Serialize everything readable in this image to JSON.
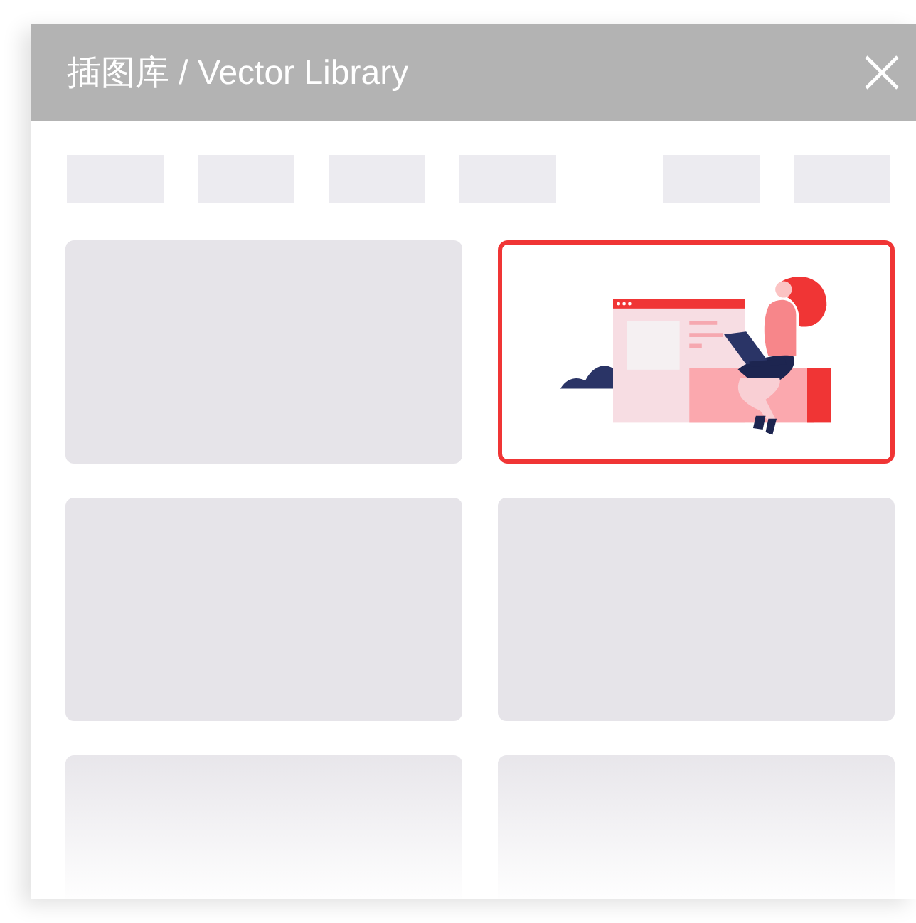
{
  "window": {
    "title": "插图库 / Vector Library"
  },
  "tabs": [
    {
      "kind": "placeholder"
    },
    {
      "kind": "placeholder"
    },
    {
      "kind": "placeholder"
    },
    {
      "kind": "placeholder"
    },
    {
      "kind": "placeholder"
    },
    {
      "kind": "placeholder"
    }
  ],
  "cards": [
    {
      "kind": "placeholder",
      "selected": false
    },
    {
      "kind": "picture",
      "selected": true
    },
    {
      "kind": "placeholder",
      "selected": false
    },
    {
      "kind": "placeholder",
      "selected": false
    },
    {
      "kind": "placeholder",
      "selected": false
    },
    {
      "kind": "placeholder",
      "selected": false
    }
  ]
}
